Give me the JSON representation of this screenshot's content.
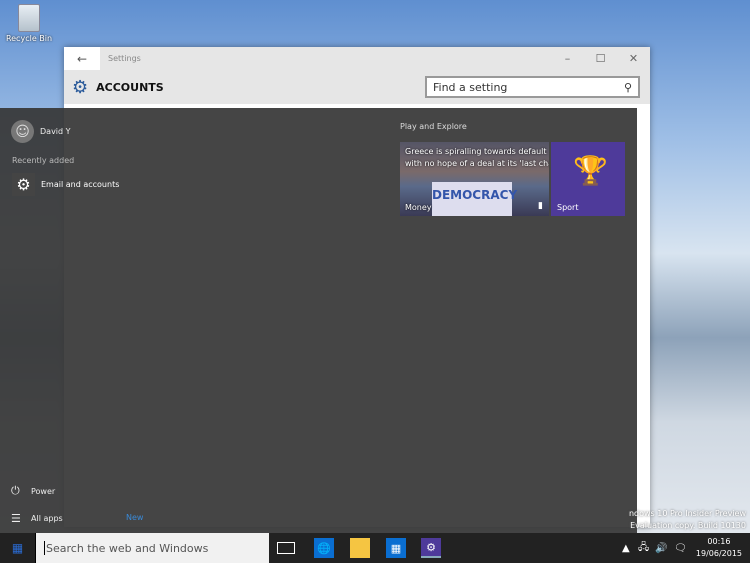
{
  "desktop": {
    "recycle_bin": "Recycle Bin",
    "watermark_line1": "ndows 10 Pro Insider Preview",
    "watermark_line2": "Evaluation copy. Build 10130"
  },
  "settings": {
    "title": "Settings",
    "heading": "ACCOUNTS",
    "search_placeholder": "Find a setting"
  },
  "start": {
    "user": "David Y",
    "recently_added": "Recently added",
    "recent_app": "Email and accounts",
    "group": "Play and Explore",
    "news_tile": {
      "headline1": "Greece is spiralling towards default",
      "headline2": "with no hope of a deal at its 'last chan",
      "label": "Money",
      "sign": "DEMOCRACY"
    },
    "sport_tile": {
      "label": "Sport",
      "color": "#4e3a9a"
    },
    "power": "Power",
    "all_apps": "All apps",
    "new_badge": "New"
  },
  "taskbar": {
    "search_placeholder": "Search the web and Windows",
    "time": "00:16",
    "date": "19/06/2015"
  }
}
